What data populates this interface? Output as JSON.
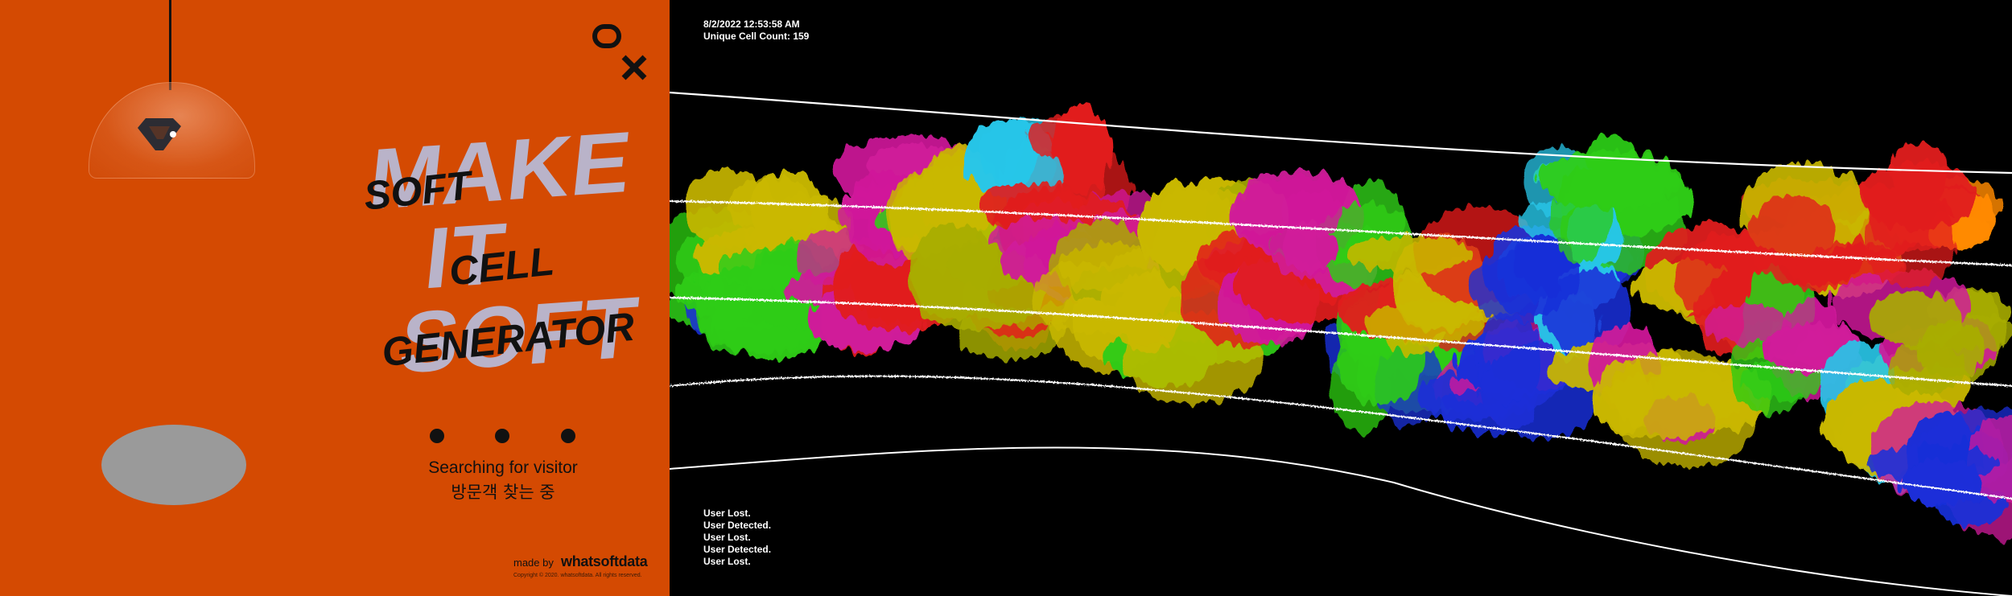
{
  "left_panel": {
    "background_color": "#d44a02",
    "lamp_logo_icon": "hexagon-chevron-icon",
    "brand_icon": "ox-logo-icon",
    "title_background_lines": [
      "MAKE",
      "IT",
      "SOFT"
    ],
    "title_foreground_lines": [
      "SOFT",
      "CELL",
      "GENERATOR"
    ],
    "status_en": "Searching for visitor",
    "status_ko": "방문객 찾는 중",
    "made_by_label": "made by",
    "brand_name": "whatsoftdata",
    "copyright": "Copyright © 2020. whatsoftdata. All rights reserved."
  },
  "right_panel": {
    "timestamp": "8/2/2022 12:53:58 AM",
    "cell_count_label": "Unique Cell Count: 159",
    "log": [
      "User Lost.",
      "User Detected.",
      "User Lost.",
      "User Detected.",
      "User Lost."
    ],
    "blob_colors": [
      "#e11d1d",
      "#c9b800",
      "#2ecc15",
      "#d01a9a",
      "#1a2fd8",
      "#27c6e8",
      "#a8ad00",
      "#ff8a00",
      "#1e6fe0",
      "#7b2bd6"
    ]
  }
}
